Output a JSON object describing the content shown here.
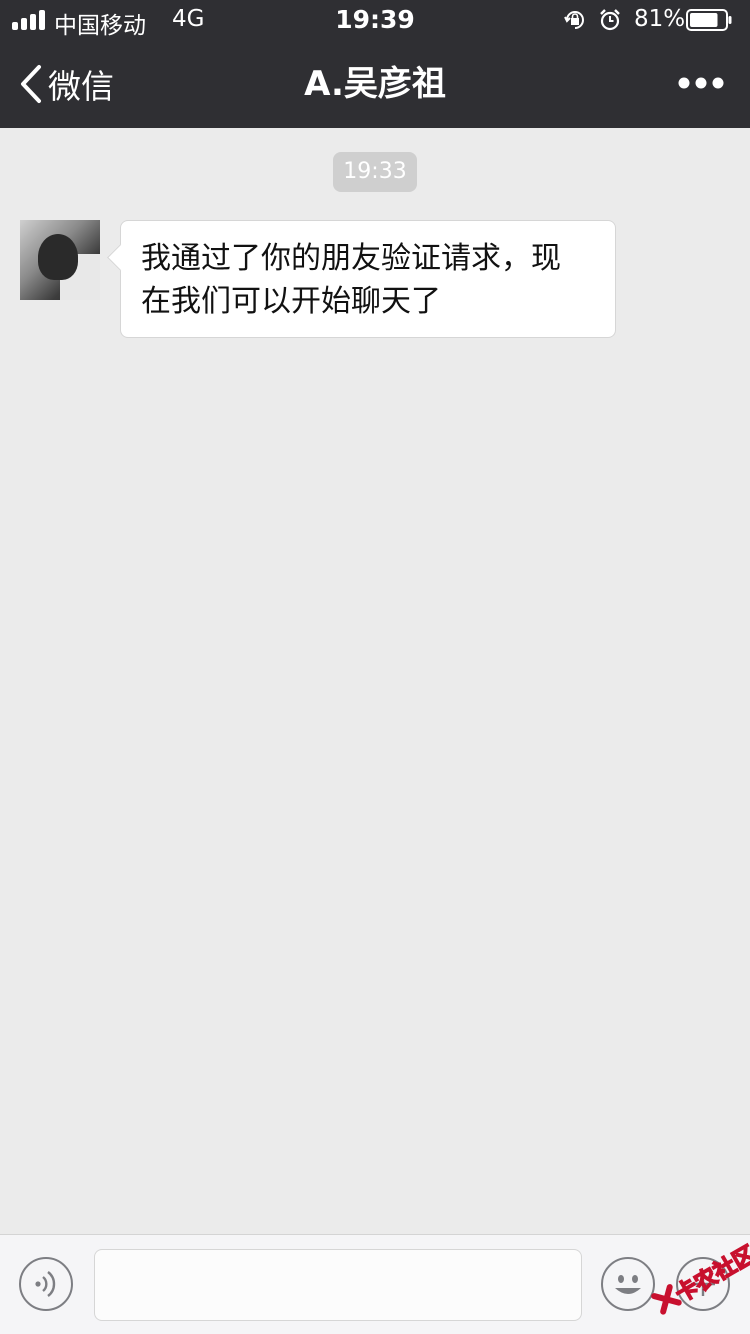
{
  "status_bar": {
    "carrier": "中国移动",
    "network": "4G",
    "time": "19:39",
    "battery_percent": "81%",
    "battery_level": 0.81,
    "icons": [
      "signal-icon",
      "orientation-lock-icon",
      "alarm-icon",
      "battery-icon"
    ]
  },
  "nav": {
    "back_label": "微信",
    "title": "A.吴彦祖",
    "more_icon": "more-dots-icon"
  },
  "chat": {
    "timestamp": "19:33",
    "messages": [
      {
        "sender": "contact",
        "lines": [
          "我通过了你的朋友验证请求，现",
          "在我们可以开始聊天了"
        ]
      }
    ]
  },
  "input_bar": {
    "voice_icon": "voice-icon",
    "emoji_icon": "emoji-icon",
    "plus_icon": "plus-icon",
    "input_value": ""
  },
  "watermark": {
    "text": "卡农社区"
  },
  "colors": {
    "bar_bg": "#2f2f33",
    "chat_bg": "#ebebeb",
    "timestamp_bg": "#cfcfcf",
    "bubble_bg": "#ffffff",
    "watermark_red": "#c8102e"
  }
}
